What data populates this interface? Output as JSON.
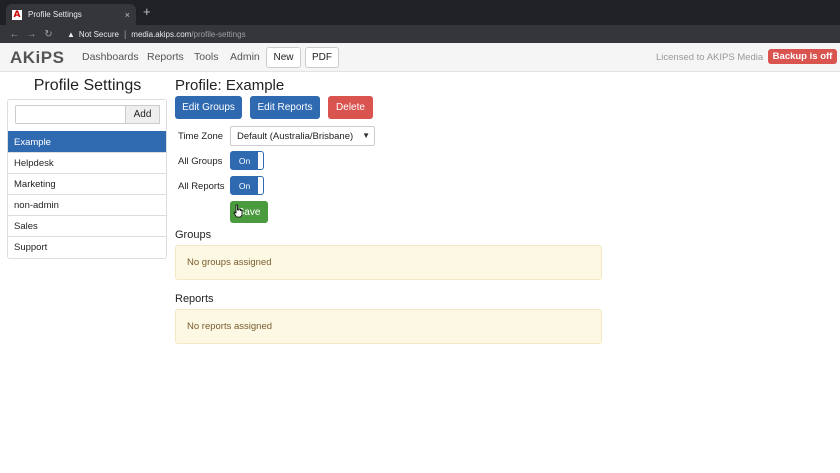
{
  "browser": {
    "tab_title": "Profile Settings",
    "favicon_letter": "A",
    "tab_close": "×",
    "new_tab": "+",
    "back": "←",
    "forward": "→",
    "reload": "↻",
    "security_label": "Not Secure",
    "url_host": "media.akips.com",
    "url_path": "/profile-settings"
  },
  "navbar": {
    "logo": "AKiPS",
    "links": [
      "Dashboards",
      "Reports",
      "Tools",
      "Admin"
    ],
    "new_label": "New",
    "pdf_label": "PDF",
    "licensed": "Licensed to AKIPS Media",
    "backup_status": "Backup is off"
  },
  "sidebar": {
    "title": "Profile Settings",
    "add_label": "Add",
    "add_input_value": "",
    "items": [
      {
        "label": "Example",
        "active": true
      },
      {
        "label": "Helpdesk",
        "active": false
      },
      {
        "label": "Marketing",
        "active": false
      },
      {
        "label": "non-admin",
        "active": false
      },
      {
        "label": "Sales",
        "active": false
      },
      {
        "label": "Support",
        "active": false
      }
    ]
  },
  "main": {
    "title": "Profile: Example",
    "edit_groups_label": "Edit Groups",
    "edit_reports_label": "Edit Reports",
    "delete_label": "Delete",
    "timezone_label": "Time Zone",
    "timezone_value": "Default (Australia/Brisbane)",
    "all_groups_label": "All Groups",
    "all_groups_toggle": "On",
    "all_reports_label": "All Reports",
    "all_reports_toggle": "On",
    "save_label": "Save",
    "groups_heading": "Groups",
    "groups_empty": "No groups assigned",
    "reports_heading": "Reports",
    "reports_empty": "No reports assigned"
  },
  "colors": {
    "primary": "#2f6ab1",
    "danger": "#d9534f",
    "success": "#4a9b3e",
    "notice_bg": "#fcf8e3"
  }
}
